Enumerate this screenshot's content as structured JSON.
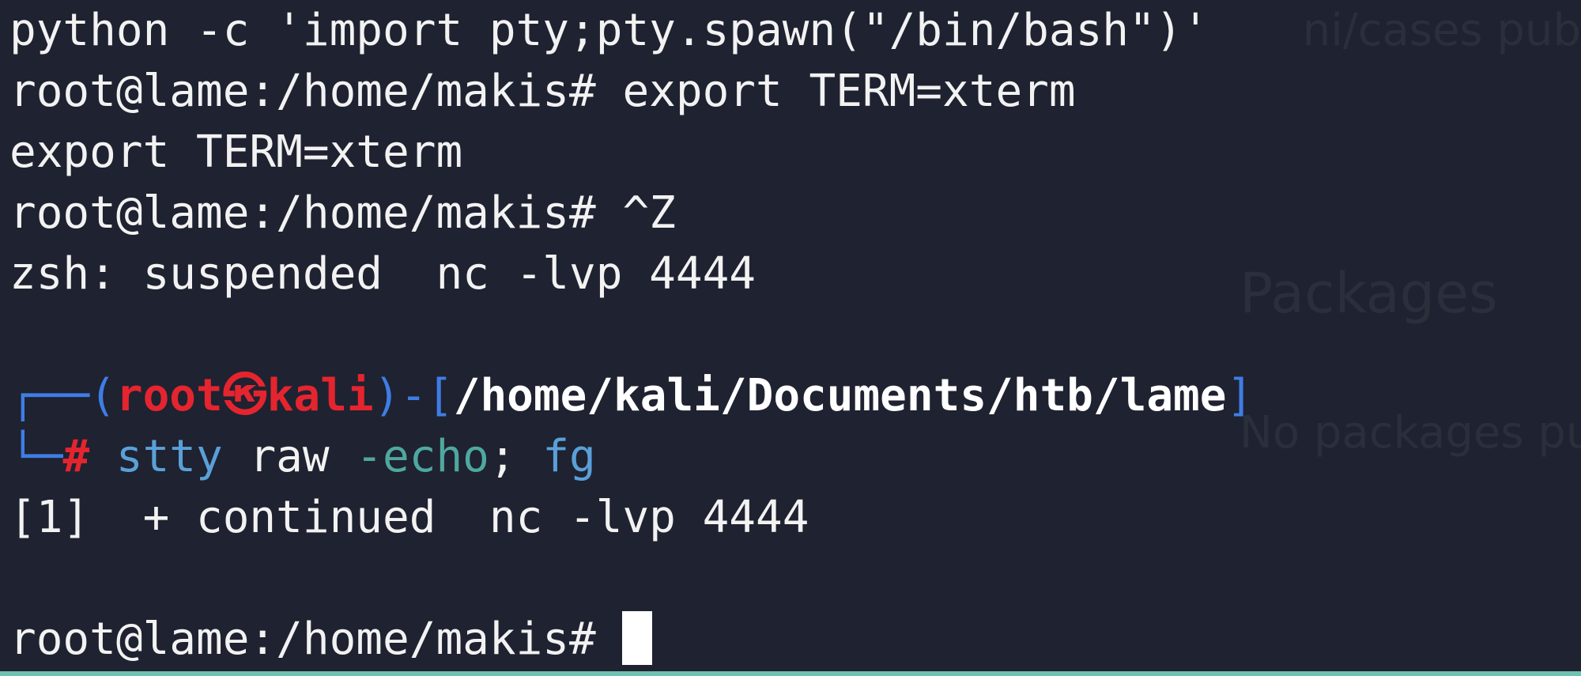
{
  "background_ghost": {
    "top_right": "ni/cases pub",
    "packages_heading": "Packages",
    "packages_empty": "No packages pub"
  },
  "lines": [
    "python -c 'import pty;pty.spawn(\"/bin/bash\")'",
    "root@lame:/home/makis# export TERM=xterm",
    "export TERM=xterm",
    "root@lame:/home/makis# ^Z",
    "zsh: suspended  nc -lvp 4444"
  ],
  "kali_prompt": {
    "box_top": "┌──(",
    "user": "root",
    "skull": "㉿",
    "host": "kali",
    "sep": ")-[",
    "cwd": "/home/kali/Documents/htb/lame",
    "close": "]",
    "box_bottom": "└─",
    "hash": "#",
    "cmd_stty": "stty",
    "cmd_raw": " raw ",
    "cmd_echo": "-echo",
    "cmd_semi": "; ",
    "cmd_fg": "fg"
  },
  "continued_line": "[1]  + continued  nc -lvp 4444",
  "final_prompt": "root@lame:/home/makis# ",
  "colors": {
    "background": "#1f2230",
    "text": "#f2f2f2",
    "prompt_red": "#e4252f",
    "box_blue": "#3f7de6",
    "accent_bar": "#6fc1b1"
  }
}
